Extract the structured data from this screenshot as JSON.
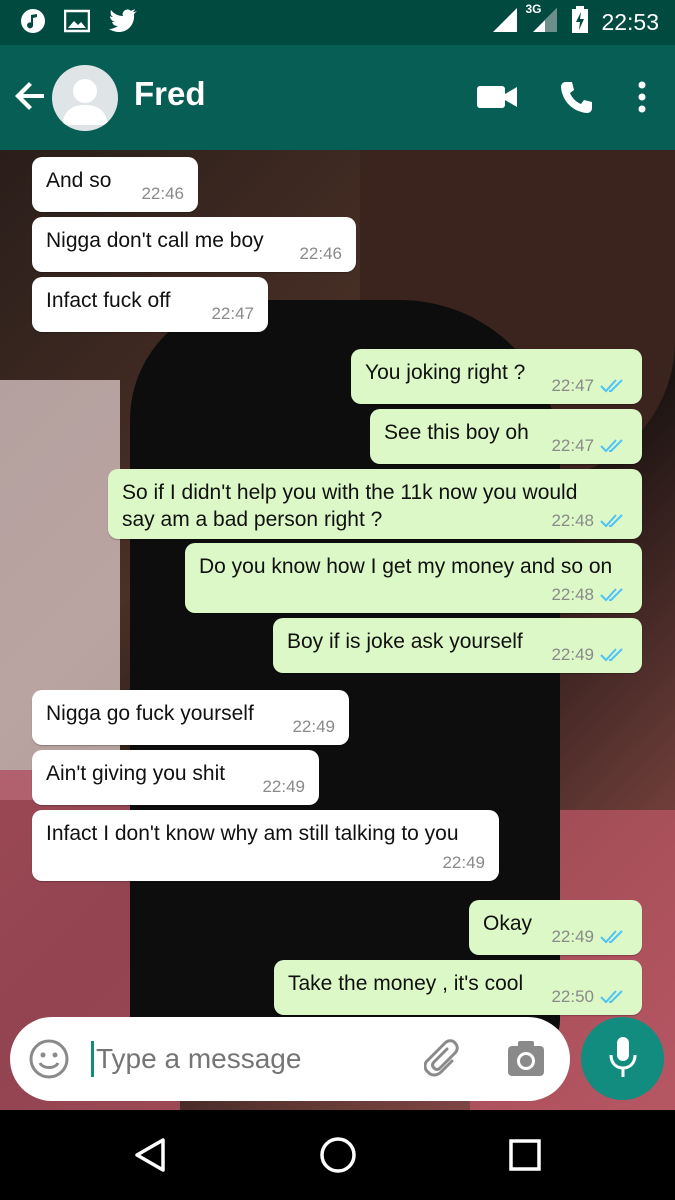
{
  "status_bar": {
    "time": "22:53",
    "network": "3G",
    "left_icons": [
      "music-note-icon",
      "image-icon",
      "twitter-icon"
    ],
    "right_icons": [
      "signal-icon",
      "signal-icon",
      "battery-charging-icon"
    ]
  },
  "header": {
    "title": "Fred",
    "icons": [
      "back-arrow-icon",
      "avatar-placeholder-icon",
      "video-call-icon",
      "phone-icon",
      "more-vert-icon"
    ]
  },
  "messages": [
    {
      "dir": "in",
      "text": "And so",
      "time": "22:46"
    },
    {
      "dir": "in",
      "text": "Nigga don't call me boy",
      "time": "22:46"
    },
    {
      "dir": "in",
      "text": "Infact fuck off",
      "time": "22:47"
    },
    {
      "dir": "out",
      "text": "You joking right ?",
      "time": "22:47",
      "status": "read"
    },
    {
      "dir": "out",
      "text": "See this boy oh",
      "time": "22:47",
      "status": "read"
    },
    {
      "dir": "out",
      "text": "So if I didn't help you with the 11k now you would say am a bad person right ?",
      "time": "22:48",
      "status": "read"
    },
    {
      "dir": "out",
      "text": "Do you know how I get my money and so on",
      "time": "22:48",
      "status": "read"
    },
    {
      "dir": "out",
      "text": "Boy if is joke ask yourself",
      "time": "22:49",
      "status": "read"
    },
    {
      "dir": "in",
      "text": "Nigga go fuck yourself",
      "time": "22:49"
    },
    {
      "dir": "in",
      "text": "Ain't giving you shit",
      "time": "22:49"
    },
    {
      "dir": "in",
      "text": "Infact I don't know why am still talking to you",
      "time": "22:49"
    },
    {
      "dir": "out",
      "text": "Okay",
      "time": "22:49",
      "status": "read"
    },
    {
      "dir": "out",
      "text": "Take the money , it's cool",
      "time": "22:50",
      "status": "read"
    }
  ],
  "composer": {
    "placeholder": "Type a message",
    "icons": [
      "emoji-icon",
      "attach-icon",
      "camera-icon",
      "mic-icon"
    ]
  },
  "nav": {
    "icons": [
      "back-triangle-icon",
      "home-circle-icon",
      "recents-square-icon"
    ]
  },
  "colors": {
    "header": "#075e54",
    "status_bar": "#004a40",
    "outgoing": "#dcf8c6",
    "incoming": "#ffffff",
    "ticks": "#4fc3f7",
    "mic": "#128c7e"
  }
}
